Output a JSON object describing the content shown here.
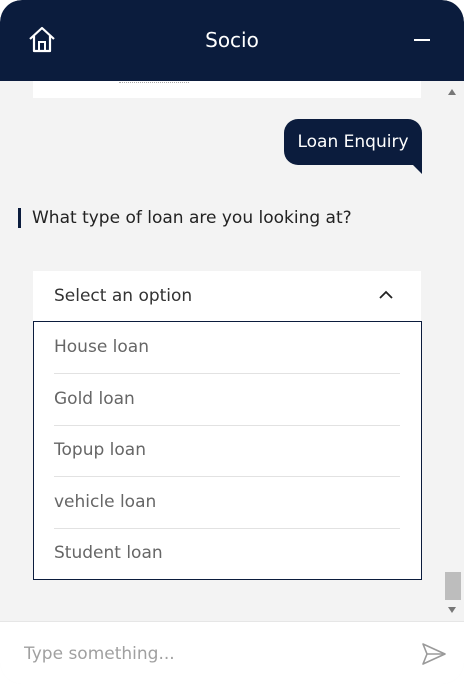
{
  "header": {
    "title": "Socio",
    "home_icon": "home-icon",
    "minimize_icon": "minimize-icon"
  },
  "messages": {
    "user_message": "Loan Enquiry",
    "bot_question": "What type of loan are you looking at?"
  },
  "select": {
    "placeholder": "Select an option",
    "options": [
      "House loan",
      "Gold loan",
      "Topup loan",
      "vehicle loan",
      "Student loan"
    ]
  },
  "composer": {
    "placeholder": "Type something...",
    "send_icon": "send-icon"
  },
  "colors": {
    "primary": "#0b1c3d",
    "background": "#f3f3f3"
  }
}
